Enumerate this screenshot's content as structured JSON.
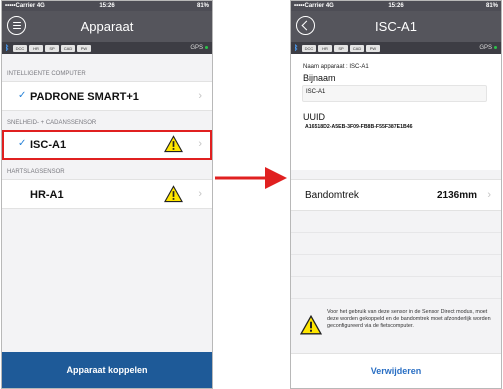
{
  "colors": {
    "navbar": "#55555c",
    "statusbar": "#4d4d55",
    "sensorbar": "#3d3d44",
    "accent_blue": "#1e5a98",
    "link_blue": "#2a6fc4",
    "highlight_red": "#e02020",
    "warning_yellow": "#ffe600"
  },
  "left": {
    "status": {
      "carrier": "•••••Carrier  4G",
      "time": "15:26",
      "battery": "81%"
    },
    "nav": {
      "title": "Apparaat",
      "menu_icon": "menu-icon"
    },
    "sensor_chips": [
      "DCC",
      "HR",
      "SP",
      "CAD",
      "PW"
    ],
    "gps": "GPS",
    "sections": [
      {
        "header": "INTELLIGENTE COMPUTER",
        "device": "PADRONE SMART+1",
        "checked": true,
        "warning": false
      },
      {
        "header": "SNELHEID- + CADANSSENSOR",
        "device": "ISC-A1",
        "checked": true,
        "warning": true,
        "highlighted": true
      },
      {
        "header": "HARTSLAGSENSOR",
        "device": "HR-A1",
        "checked": false,
        "warning": true
      }
    ],
    "connect_button": "Apparaat koppelen"
  },
  "right": {
    "status": {
      "carrier": "•••••Carrier  4G",
      "time": "15:26",
      "battery": "81%"
    },
    "nav": {
      "title": "ISC-A1",
      "back_icon": "back-chevron-icon"
    },
    "sensor_chips": [
      "DCC",
      "HR",
      "SP",
      "CAD",
      "PW"
    ],
    "gps": "GPS",
    "device_name_label": "Naam apparaat : ISC-A1",
    "nickname_label": "Bijnaam",
    "nickname_value": "ISC-A1",
    "uuid_label": "UUID",
    "uuid_value": "A16518D2-A5EB-3F09-FB8B-F55F387E1B46",
    "wheel_label": "Bandomtrek",
    "wheel_value": "2136mm",
    "notice": "Voor het gebruik van deze sensor in de Sensor Direct modus, moet deze worden gekoppeld en de bandomtrek moet afzonderlijk worden geconfigureerd via de fietscomputer.",
    "delete_button": "Verwijderen"
  }
}
